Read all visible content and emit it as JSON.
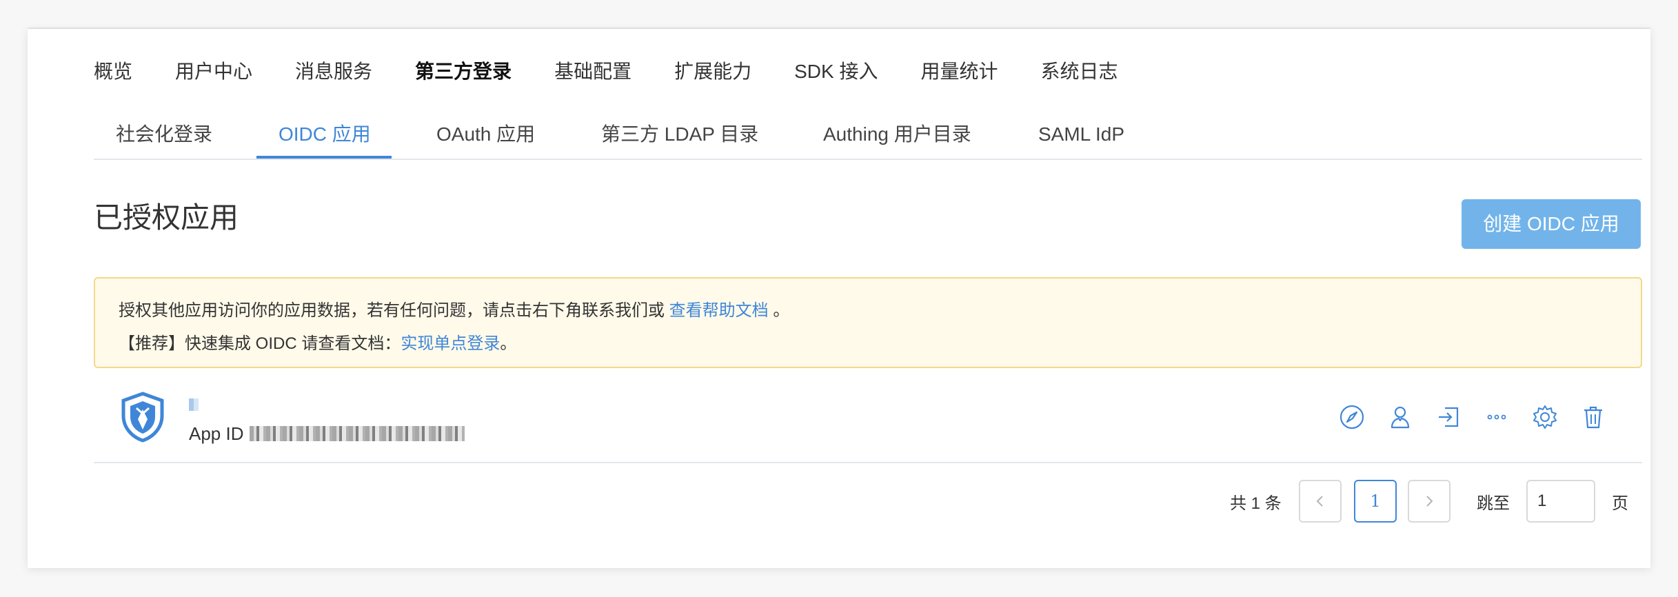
{
  "main_nav": [
    {
      "label": "概览"
    },
    {
      "label": "用户中心"
    },
    {
      "label": "消息服务"
    },
    {
      "label": "第三方登录",
      "active": true
    },
    {
      "label": "基础配置"
    },
    {
      "label": "扩展能力"
    },
    {
      "label": "SDK 接入"
    },
    {
      "label": "用量统计"
    },
    {
      "label": "系统日志"
    }
  ],
  "sub_nav": [
    {
      "label": "社会化登录"
    },
    {
      "label": "OIDC 应用",
      "active": true
    },
    {
      "label": "OAuth 应用"
    },
    {
      "label": "第三方 LDAP 目录"
    },
    {
      "label": "Authing 用户目录"
    },
    {
      "label": "SAML IdP"
    }
  ],
  "section": {
    "title": "已授权应用",
    "create_button": "创建 OIDC 应用"
  },
  "notice": {
    "line1_text": "授权其他应用访问你的应用数据，若有任何问题，请点击右下角联系我们或 ",
    "line1_link": "查看帮助文档",
    "line1_end": " 。",
    "line2_text": "【推荐】快速集成 OIDC 请查看文档：",
    "line2_link": "实现单点登录",
    "line2_end": "。"
  },
  "app": {
    "app_id_label": "App ID",
    "actions": [
      "compass-icon",
      "user-icon",
      "login-icon",
      "more-icon",
      "settings-icon",
      "trash-icon"
    ]
  },
  "pagination": {
    "total": "共 1 条",
    "current_page": "1",
    "jump_label": "跳至",
    "jump_value": "1",
    "page_unit": "页"
  },
  "colors": {
    "accent": "#3f86d8",
    "button": "#72b4ea",
    "notice_bg": "#fffaea",
    "notice_border": "#f3d98a"
  }
}
